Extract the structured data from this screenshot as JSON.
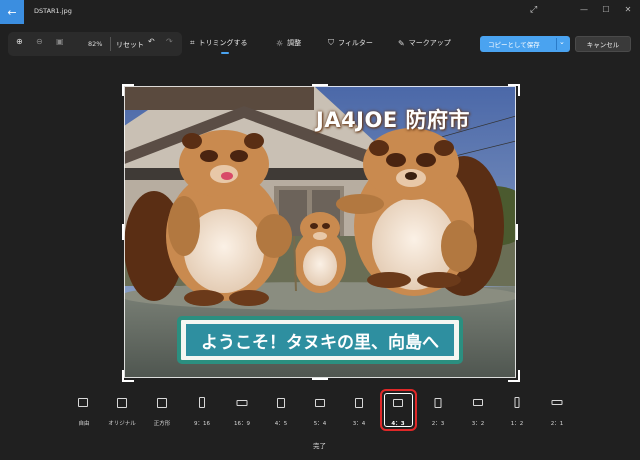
{
  "titlebar": {
    "filename": "DSTAR1.jpg",
    "back_icon": "arrow-left-icon"
  },
  "toolbar": {
    "zoom_value": "82%",
    "reset_label": "リセット",
    "crop_label": "トリミングする",
    "adjust_label": "調整",
    "filter_label": "フィルター",
    "markup_label": "マークアップ",
    "save_label": "コピーとして保存",
    "cancel_label": "キャンセル"
  },
  "photo": {
    "watermark": "JA4JOE 防府市",
    "sign_text": "ようこそ！タヌキの里、向島へ"
  },
  "aspect_ratios": [
    "自由",
    "オリジナル",
    "正方形",
    "9：16",
    "16：9",
    "4：5",
    "5：4",
    "3：4",
    "4：3",
    "2：3",
    "3：2",
    "1：2",
    "2：1"
  ],
  "selected_aspect": "4：3",
  "done_label": "完了",
  "colors": {
    "accent": "#4aa3f0",
    "selection": "#e02828",
    "background": "#202020"
  }
}
